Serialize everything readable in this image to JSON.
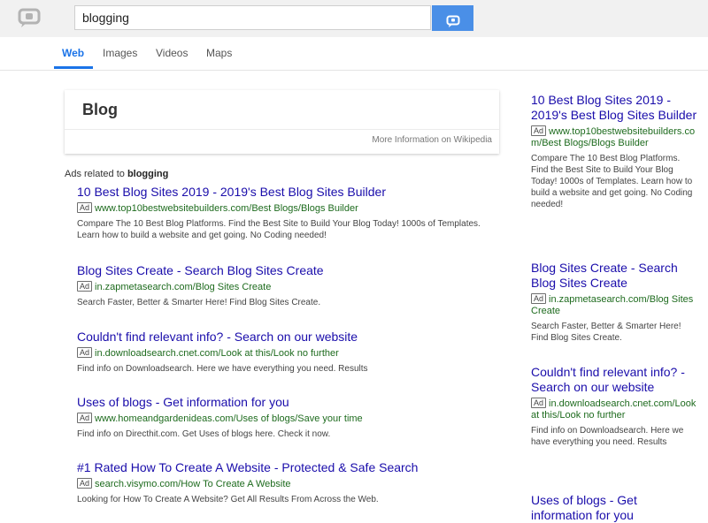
{
  "search": {
    "query": "blogging"
  },
  "tabs": [
    {
      "label": "Web"
    },
    {
      "label": "Images"
    },
    {
      "label": "Videos"
    },
    {
      "label": "Maps"
    }
  ],
  "infocard": {
    "title": "Blog",
    "link": "More Information on Wikipedia"
  },
  "ads_label": {
    "prefix": "Ads related to ",
    "query": "blogging"
  },
  "ad_badge": "Ad",
  "main_ads": [
    {
      "title": "10 Best Blog Sites 2019 - 2019's Best Blog Sites Builder",
      "url": "www.top10bestwebsitebuilders.com/Best Blogs/Blogs Builder",
      "desc": "Compare The 10 Best Blog Platforms. Find the Best Site to Build Your Blog Today! 1000s of Templates. Learn how to build a website and get going. No Coding needed!"
    },
    {
      "title": "Blog Sites Create - Search Blog Sites Create",
      "url": "in.zapmetasearch.com/Blog Sites Create",
      "desc": "Search Faster, Better & Smarter Here! Find Blog Sites Create."
    },
    {
      "title": "Couldn't find relevant info? - Search on our website",
      "url": "in.downloadsearch.cnet.com/Look at this/Look no further",
      "desc": "Find info on Downloadsearch. Here we have everything you need. Results"
    },
    {
      "title": "Uses of blogs - Get information for you",
      "url": "www.homeandgardenideas.com/Uses of blogs/Save your time",
      "desc": "Find info on Directhit.com. Get Uses of blogs here. Check it now."
    },
    {
      "title": "#1 Rated How To Create A Website - Protected & Safe Search",
      "url": "search.visymo.com/How To Create A Website",
      "desc": "Looking for How To Create A Website? Get All Results From Across the Web."
    }
  ],
  "side_ads": [
    {
      "title": "10 Best Blog Sites 2019 - 2019's Best Blog Sites Builder",
      "url": "www.top10bestwebsitebuilders.com/Best Blogs/Blogs Builder",
      "desc": "Compare The 10 Best Blog Platforms. Find the Best Site to Build Your Blog Today! 1000s of Templates. Learn how to build a website and get going. No Coding needed!"
    },
    {
      "title": "Blog Sites Create - Search Blog Sites Create",
      "url": "in.zapmetasearch.com/Blog Sites Create",
      "desc": "Search Faster, Better & Smarter Here! Find Blog Sites Create."
    },
    {
      "title": "Couldn't find relevant info? - Search on our website",
      "url": "in.downloadsearch.cnet.com/Look at this/Look no further",
      "desc": "Find info on Downloadsearch. Here we have everything you need. Results"
    },
    {
      "title": "Uses of blogs - Get information for you"
    }
  ],
  "colors": {
    "accent": "#1a73e8",
    "link": "#1a0dab",
    "url": "#1e6b1e",
    "search_button": "#4a8fe7",
    "topbar": "#f1f1f1"
  },
  "icons": {
    "logo": "speech-bubble-logo-icon",
    "search_button": "speech-bubble-search-icon"
  }
}
